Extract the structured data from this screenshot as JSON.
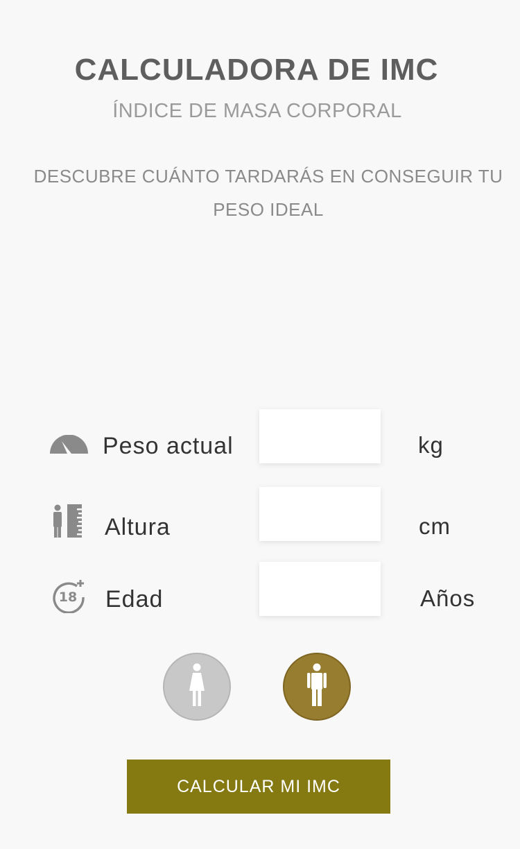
{
  "header": {
    "title": "CALCULADORA DE IMC",
    "subtitle": "ÍNDICE DE MASA CORPORAL",
    "tagline": "DESCUBRE CUÁNTO TARDARÁS EN CONSEGUIR TU PESO IDEAL"
  },
  "form": {
    "weight": {
      "label": "Peso actual",
      "value": "",
      "unit": "kg",
      "icon": "scale-gauge-icon"
    },
    "height": {
      "label": "Altura",
      "value": "",
      "unit": "cm",
      "icon": "height-ruler-icon"
    },
    "age": {
      "label": "Edad",
      "value": "",
      "unit": "Años",
      "icon": "age-18-plus-icon"
    }
  },
  "gender": {
    "options": [
      "female",
      "male"
    ],
    "selected": "male",
    "colors": {
      "inactive": "#c8c8c8",
      "active": "#977d30"
    }
  },
  "actions": {
    "calculate_label": "CALCULAR MI IMC",
    "button_color": "#857a12"
  }
}
